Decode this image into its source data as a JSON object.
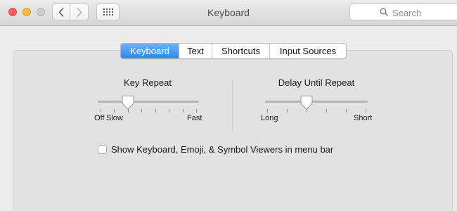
{
  "window": {
    "title": "Keyboard"
  },
  "toolbar": {
    "search_placeholder": "Search",
    "icons": {
      "back": "chevron-left-icon",
      "forward": "chevron-right-icon",
      "show_all": "grid-icon",
      "search": "magnifier-icon"
    }
  },
  "tabs": [
    {
      "label": "Keyboard",
      "selected": true
    },
    {
      "label": "Text",
      "selected": false
    },
    {
      "label": "Shortcuts",
      "selected": false
    },
    {
      "label": "Input Sources",
      "selected": false
    }
  ],
  "key_repeat": {
    "title": "Key Repeat",
    "min_label": "Off",
    "slow_label": "Slow",
    "max_label": "Fast",
    "stops": 8,
    "value_stop": 2
  },
  "delay_until_repeat": {
    "title": "Delay Until Repeat",
    "min_label": "Long",
    "max_label": "Short",
    "stops": 6,
    "value_stop": 2
  },
  "options": {
    "show_viewers_label": "Show Keyboard, Emoji, & Symbol Viewers in menu bar",
    "show_viewers_checked": false
  },
  "colors": {
    "accent": "#2f86f0",
    "close": "#fc605c",
    "minimize": "#fdbc40",
    "zoom_disabled": "#cfcfcf"
  }
}
